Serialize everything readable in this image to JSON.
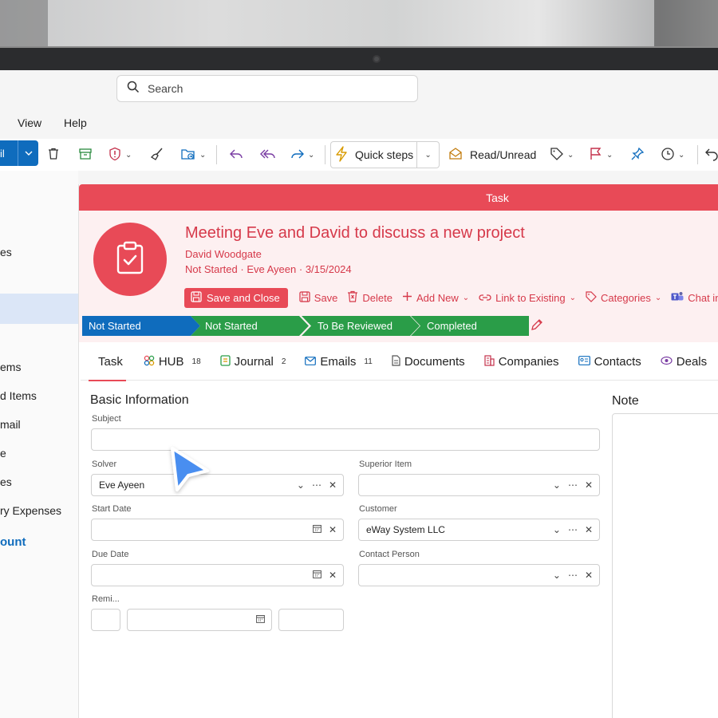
{
  "search": {
    "placeholder": "Search"
  },
  "menu": {
    "view": "View",
    "help": "Help"
  },
  "ribbon": {
    "new_label": "il",
    "quick_steps": "Quick steps",
    "read_unread": "Read/Unread"
  },
  "leftnav": {
    "items": [
      "es",
      "ems",
      "d Items",
      "mail",
      "e",
      "es",
      "ry Expenses"
    ],
    "account": "ount"
  },
  "task": {
    "window_title": "Task",
    "subject": "Meeting Eve and David to discuss a new project",
    "owner": "David Woodgate",
    "status": "Not Started",
    "solver": "Eve Ayeen",
    "date": "3/15/2024",
    "actions": {
      "save_close": "Save and Close",
      "save": "Save",
      "delete": "Delete",
      "add_new": "Add New",
      "link_existing": "Link to Existing",
      "categories": "Categories",
      "chat": "Chat in Te"
    },
    "pipeline": [
      {
        "label": "Not Started",
        "color": "#0f6cbd"
      },
      {
        "label": "Not Started",
        "color": "#2a9d48"
      },
      {
        "label": "To Be Reviewed",
        "color": "#2a9d48"
      },
      {
        "label": "Completed",
        "color": "#2a9d48"
      }
    ],
    "tabs": [
      {
        "label": "Task",
        "count": ""
      },
      {
        "label": "HUB",
        "count": "18"
      },
      {
        "label": "Journal",
        "count": "2"
      },
      {
        "label": "Emails",
        "count": "11"
      },
      {
        "label": "Documents",
        "count": ""
      },
      {
        "label": "Companies",
        "count": ""
      },
      {
        "label": "Contacts",
        "count": ""
      },
      {
        "label": "Deals",
        "count": ""
      }
    ]
  },
  "form": {
    "section_title": "Basic Information",
    "note_title": "Note",
    "subject_label": "Subject",
    "subject_value": "",
    "solver_label": "Solver",
    "solver_value": "Eve Ayeen",
    "superior_label": "Superior Item",
    "superior_value": "",
    "start_label": "Start Date",
    "start_value": "",
    "customer_label": "Customer",
    "customer_value": "eWay System LLC",
    "due_label": "Due Date",
    "due_value": "",
    "contact_label": "Contact Person",
    "contact_value": "",
    "reminder_label": "Remi..."
  },
  "colors": {
    "accent": "#e84a57",
    "header_bg": "#fdf0f1",
    "outlook_blue": "#0f6cbd",
    "stage_green": "#2a9d48"
  }
}
